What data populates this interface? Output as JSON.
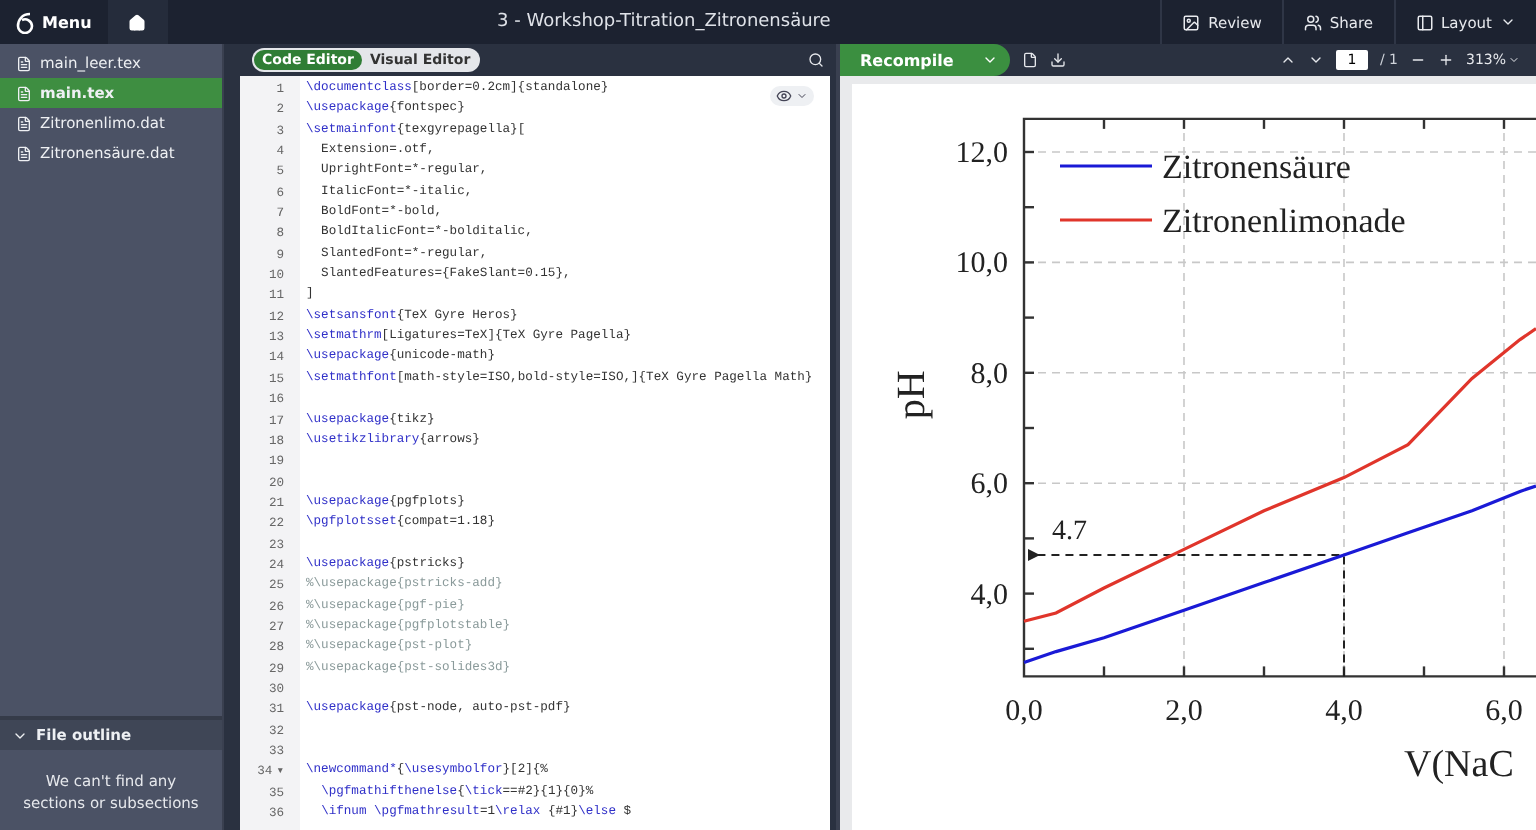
{
  "topbar": {
    "menu": "Menu",
    "title": "3 - Workshop-Titration_Zitronensäure",
    "actions": [
      {
        "kind": "review",
        "label": "Review"
      },
      {
        "kind": "share",
        "label": "Share"
      },
      {
        "kind": "layout",
        "label": "Layout"
      }
    ]
  },
  "files": [
    {
      "name": "main_leer.tex",
      "selected": false
    },
    {
      "name": "main.tex",
      "selected": true
    },
    {
      "name": "Zitronenlimo.dat",
      "selected": false
    },
    {
      "name": "Zitronensäure.dat",
      "selected": false
    }
  ],
  "outline": {
    "title": "File outline",
    "expanded": true,
    "message": "We can't find any sections or subsections"
  },
  "editor": {
    "modes": [
      {
        "label": "Code Editor",
        "selected": true
      },
      {
        "label": "Visual Editor",
        "selected": false
      }
    ],
    "lines": [
      {
        "no": "1",
        "text": "\\documentclass[border=0.2cm]{standalone}"
      },
      {
        "no": "2",
        "text": "\\usepackage{fontspec}"
      },
      {
        "no": "3",
        "text": "\\setmainfont{texgyrepagella}["
      },
      {
        "no": "4",
        "text": "  Extension=.otf,"
      },
      {
        "no": "5",
        "text": "  UprightFont=*-regular,"
      },
      {
        "no": "6",
        "text": "  ItalicFont=*-italic,"
      },
      {
        "no": "7",
        "text": "  BoldFont=*-bold,"
      },
      {
        "no": "8",
        "text": "  BoldItalicFont=*-bolditalic,"
      },
      {
        "no": "9",
        "text": "  SlantedFont=*-regular,"
      },
      {
        "no": "10",
        "text": "  SlantedFeatures={FakeSlant=0.15},"
      },
      {
        "no": "11",
        "text": "]"
      },
      {
        "no": "12",
        "text": "\\setsansfont{TeX Gyre Heros}"
      },
      {
        "no": "13",
        "text": "\\setmathrm[Ligatures=TeX]{TeX Gyre Pagella}"
      },
      {
        "no": "14",
        "text": "\\usepackage{unicode-math}"
      },
      {
        "no": "15",
        "text": "\\setmathfont[math-style=ISO,bold-style=ISO,]{TeX Gyre Pagella Math}"
      },
      {
        "no": "16"
      },
      {
        "no": "17",
        "text": "\\usepackage{tikz}"
      },
      {
        "no": "18",
        "text": "\\usetikzlibrary{arrows}"
      },
      {
        "no": "19"
      },
      {
        "no": "20"
      },
      {
        "no": "21",
        "text": "\\usepackage{pgfplots}"
      },
      {
        "no": "22",
        "text": "\\pgfplotsset{compat=1.18}"
      },
      {
        "no": "23"
      },
      {
        "no": "24",
        "text": "\\usepackage{pstricks}"
      },
      {
        "no": "25",
        "text": "%\\usepackage{pstricks-add}"
      },
      {
        "no": "26",
        "text": "%\\usepackage{pgf-pie}"
      },
      {
        "no": "27",
        "text": "%\\usepackage{pgfplotstable}"
      },
      {
        "no": "28",
        "text": "%\\usepackage{pst-plot}"
      },
      {
        "no": "29",
        "text": "%\\usepackage{pst-solides3d}"
      },
      {
        "no": "30"
      },
      {
        "no": "31",
        "text": "\\usepackage{pst-node, auto-pst-pdf}"
      },
      {
        "no": "32"
      },
      {
        "no": "33"
      },
      {
        "no": "34",
        "fold": "▾",
        "text": "\\newcommand*{\\usesymbolfor}[2]{%"
      },
      {
        "no": "35",
        "text": "  \\pgfmathifthenelse{\\tick==#2}{1}{0}%"
      },
      {
        "no": "36",
        "text": "  \\ifnum \\pgfmathresult=1\\relax {#1}\\else $"
      }
    ]
  },
  "pdf": {
    "recompile": "Recompile",
    "page": "1",
    "pages": "/ 1",
    "zoom": "313%",
    "chart_data": {
      "type": "line",
      "xlabel": "V(NaC",
      "ylabel": "pH",
      "xlim": [
        0,
        6.4
      ],
      "ylim": [
        2.5,
        12.6
      ],
      "xticks": [
        {
          "value": 0,
          "label": "0,0"
        },
        {
          "value": 2,
          "label": "2,0"
        },
        {
          "value": 4,
          "label": "4,0"
        },
        {
          "value": 6,
          "label": "6,0"
        }
      ],
      "yticks": [
        {
          "value": 4,
          "label": "4,0"
        },
        {
          "value": 6,
          "label": "6,0"
        },
        {
          "value": 8,
          "label": "8,0"
        },
        {
          "value": 10,
          "label": "10,0"
        },
        {
          "value": 12,
          "label": "12,0"
        }
      ],
      "x": [
        0,
        0.4,
        1,
        2,
        3,
        4,
        4.8,
        5.6,
        6.2,
        6.4
      ],
      "series": [
        {
          "name": "Zitronensäure",
          "color": "#1a1ad6",
          "values": [
            2.75,
            2.95,
            3.2,
            3.7,
            4.2,
            4.7,
            5.1,
            5.5,
            5.85,
            5.95
          ]
        },
        {
          "name": "Zitronenlimonade",
          "color": "#e0352b",
          "values": [
            3.5,
            3.65,
            4.1,
            4.8,
            5.5,
            6.1,
            6.7,
            7.9,
            8.6,
            8.8
          ]
        }
      ],
      "grid": true,
      "legend": true,
      "annotations": [
        "4.7"
      ]
    }
  }
}
